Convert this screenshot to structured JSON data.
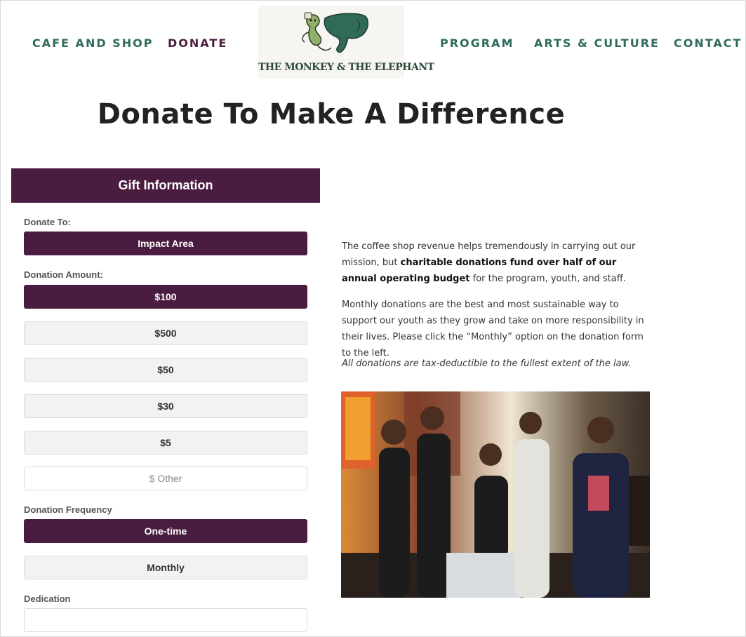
{
  "nav": {
    "cafe": "CAFE AND SHOP",
    "donate": "DONATE",
    "program": "PROGRAM",
    "arts": "ARTS & CULTURE",
    "contact": "CONTACT"
  },
  "logo": {
    "text": "THE MONKEY & THE ELEPHANT"
  },
  "page_title": "Donate To Make A Difference",
  "form": {
    "header": "Gift Information",
    "donate_to_label": "Donate To:",
    "donate_to_value": "Impact Area",
    "amount_label": "Donation Amount:",
    "amounts": [
      "$100",
      "$500",
      "$50",
      "$30",
      "$5"
    ],
    "selected_amount": "$100",
    "other_placeholder": "$ Other",
    "frequency_label": "Donation Frequency",
    "frequencies": [
      "One-time",
      "Monthly"
    ],
    "selected_frequency": "One-time",
    "dedication_label": "Dedication",
    "dedication_value": ""
  },
  "copy": {
    "p1_start": "The coffee shop revenue helps tremendously in carrying out our mission, but ",
    "p1_bold": "charitable donations fund over half of our annual operating budget",
    "p1_end": " for the program, youth, and staff.",
    "p2": "Monthly donations are the best and most sustainable way to support our youth as they grow and take on more responsibility in their lives. Please click the “Monthly” option on the donation form to the left.",
    "p3": "All donations are tax-deductible to the fullest extent of the law."
  },
  "colors": {
    "brand_purple": "#4a1d40",
    "nav_green": "#2e6b5c"
  }
}
